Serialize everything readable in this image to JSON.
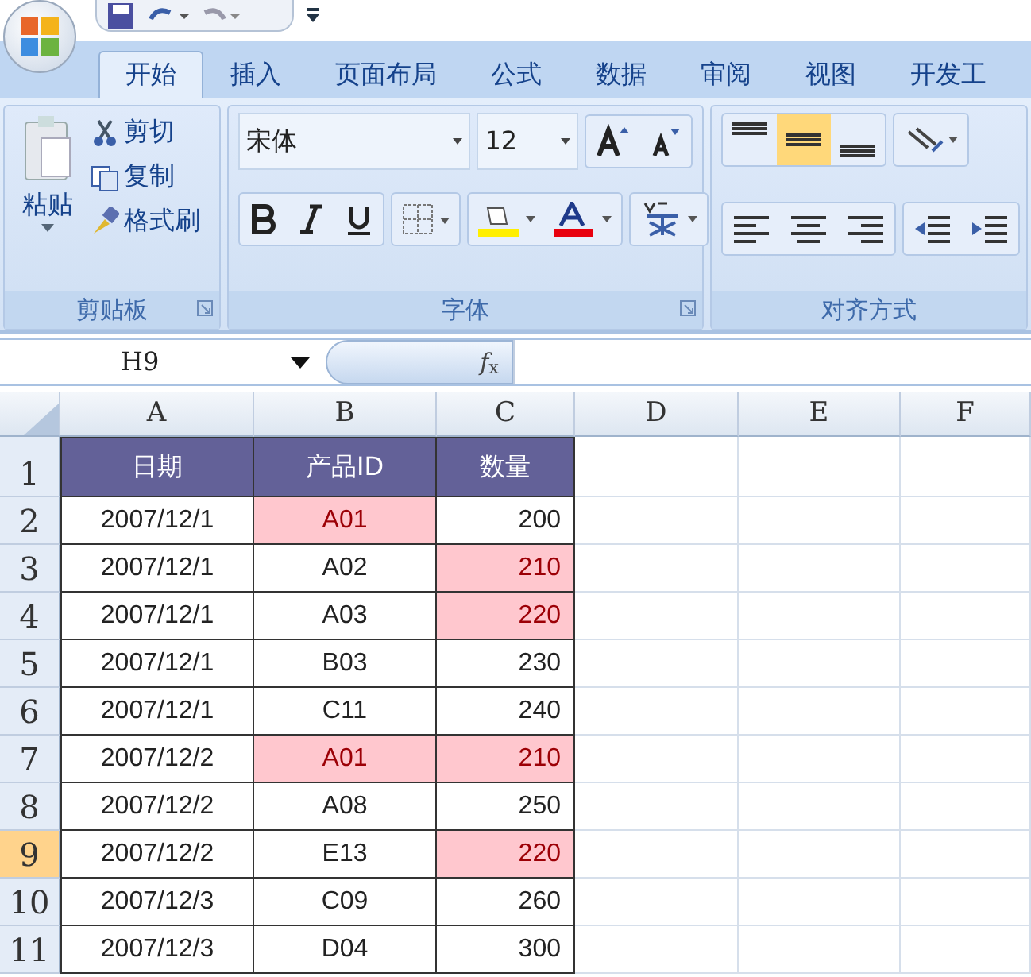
{
  "tabs": [
    {
      "label": "开始",
      "selected": true
    },
    {
      "label": "插入",
      "selected": false
    },
    {
      "label": "页面布局",
      "selected": false
    },
    {
      "label": "公式",
      "selected": false
    },
    {
      "label": "数据",
      "selected": false
    },
    {
      "label": "审阅",
      "selected": false
    },
    {
      "label": "视图",
      "selected": false
    },
    {
      "label": "开发工",
      "selected": false
    }
  ],
  "clipboard": {
    "paste": "粘贴",
    "cut": "剪切",
    "copy": "复制",
    "format_painter": "格式刷",
    "label": "剪贴板"
  },
  "font": {
    "font_name": "宋体",
    "font_size": "12",
    "label": "字体"
  },
  "alignment": {
    "label": "对齐方式",
    "vertical": [
      {
        "selected": false
      },
      {
        "selected": true
      },
      {
        "selected": false
      }
    ]
  },
  "formula_bar": {
    "cell_ref": "H9",
    "function_label": "*f*$_{x}$"
  },
  "sheet": {
    "columns": [
      "A",
      "B",
      "C",
      "D",
      "E",
      "F"
    ],
    "rows": [
      {
        "header": "1",
        "selected": false,
        "cells": [
          {
            "text": "日期",
            "kind": "heading",
            "highlighted": false
          },
          {
            "text": "产品ID",
            "kind": "heading",
            "highlighted": false
          },
          {
            "text": "数量",
            "kind": "heading",
            "highlighted": false
          }
        ]
      },
      {
        "header": "2",
        "selected": false,
        "cells": [
          {
            "text": "2007/12/1",
            "kind": "date",
            "highlighted": false
          },
          {
            "text": "A01",
            "kind": "code",
            "highlighted": true
          },
          {
            "text": "200",
            "kind": "number",
            "highlighted": false
          }
        ]
      },
      {
        "header": "3",
        "selected": false,
        "cells": [
          {
            "text": "2007/12/1",
            "kind": "date",
            "highlighted": false
          },
          {
            "text": "A02",
            "kind": "code",
            "highlighted": false
          },
          {
            "text": "210",
            "kind": "number",
            "highlighted": true
          }
        ]
      },
      {
        "header": "4",
        "selected": false,
        "cells": [
          {
            "text": "2007/12/1",
            "kind": "date",
            "highlighted": false
          },
          {
            "text": "A03",
            "kind": "code",
            "highlighted": false
          },
          {
            "text": "220",
            "kind": "number",
            "highlighted": true
          }
        ]
      },
      {
        "header": "5",
        "selected": false,
        "cells": [
          {
            "text": "2007/12/1",
            "kind": "date",
            "highlighted": false
          },
          {
            "text": "B03",
            "kind": "code",
            "highlighted": false
          },
          {
            "text": "230",
            "kind": "number",
            "highlighted": false
          }
        ]
      },
      {
        "header": "6",
        "selected": false,
        "cells": [
          {
            "text": "2007/12/1",
            "kind": "date",
            "highlighted": false
          },
          {
            "text": "C11",
            "kind": "code",
            "highlighted": false
          },
          {
            "text": "240",
            "kind": "number",
            "highlighted": false
          }
        ]
      },
      {
        "header": "7",
        "selected": false,
        "cells": [
          {
            "text": "2007/12/2",
            "kind": "date",
            "highlighted": false
          },
          {
            "text": "A01",
            "kind": "code",
            "highlighted": true
          },
          {
            "text": "210",
            "kind": "number",
            "highlighted": true
          }
        ]
      },
      {
        "header": "8",
        "selected": false,
        "cells": [
          {
            "text": "2007/12/2",
            "kind": "date",
            "highlighted": false
          },
          {
            "text": "A08",
            "kind": "code",
            "highlighted": false
          },
          {
            "text": "250",
            "kind": "number",
            "highlighted": false
          }
        ]
      },
      {
        "header": "9",
        "selected": true,
        "cells": [
          {
            "text": "2007/12/2",
            "kind": "date",
            "highlighted": false
          },
          {
            "text": "E13",
            "kind": "code",
            "highlighted": false
          },
          {
            "text": "220",
            "kind": "number",
            "highlighted": true
          }
        ]
      },
      {
        "header": "10",
        "selected": false,
        "cells": [
          {
            "text": "2007/12/3",
            "kind": "date",
            "highlighted": false
          },
          {
            "text": "C09",
            "kind": "code",
            "highlighted": false
          },
          {
            "text": "260",
            "kind": "number",
            "highlighted": false
          }
        ]
      },
      {
        "header": "11",
        "selected": false,
        "cells": [
          {
            "text": "2007/12/3",
            "kind": "date",
            "highlighted": false
          },
          {
            "text": "D04",
            "kind": "code",
            "highlighted": false
          },
          {
            "text": "300",
            "kind": "number",
            "highlighted": false
          }
        ]
      }
    ]
  }
}
